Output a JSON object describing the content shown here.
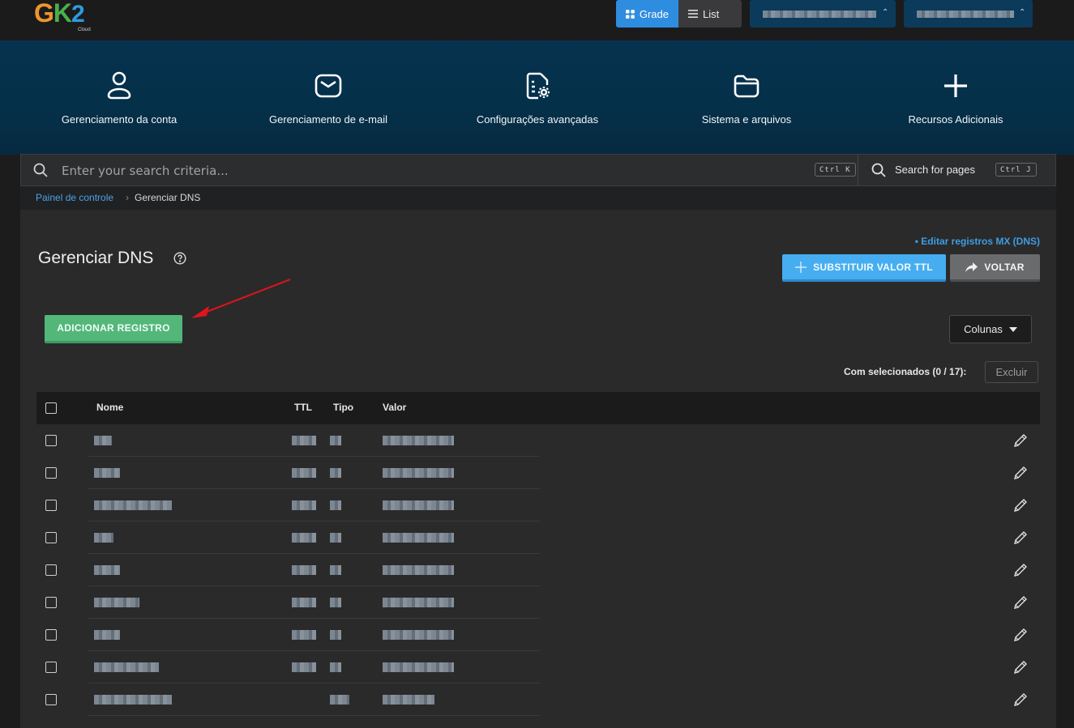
{
  "logo": {
    "g": "G",
    "k": "K",
    "two": "2",
    "sub": "Cloud"
  },
  "view_toggle": {
    "grade": "Grade",
    "list": "List"
  },
  "hero": [
    {
      "label": "Gerenciamento da conta",
      "icon": "user-icon"
    },
    {
      "label": "Gerenciamento de e-mail",
      "icon": "mail-icon"
    },
    {
      "label": "Configurações avançadas",
      "icon": "file-settings-icon"
    },
    {
      "label": "Sistema e arquivos",
      "icon": "folder-icon"
    },
    {
      "label": "Recursos Adicionais",
      "icon": "plus-icon"
    }
  ],
  "search": {
    "placeholder": "Enter your search criteria...",
    "shortcut": "Ctrl K",
    "pages_label": "Search for pages",
    "pages_shortcut": "Ctrl J"
  },
  "breadcrumb": {
    "home": "Painel de controle",
    "separator": "›",
    "current": "Gerenciar DNS"
  },
  "page": {
    "title": "Gerenciar DNS",
    "mx_link": "• Editar registros MX (DNS)",
    "ttl_button": "SUBSTITUIR VALOR TTL",
    "back_button": "VOLTAR",
    "add_button": "ADICIONAR REGISTRO",
    "columns_button": "Colunas",
    "selected_label": "Com selecionados (0 / 17):",
    "delete_button": "Excluir"
  },
  "table": {
    "headers": {
      "name": "Nome",
      "ttl": "TTL",
      "type": "Tipo",
      "value": "Valor"
    },
    "rows": [
      {
        "name_w": 22,
        "ttl_w": 30,
        "type_w": 14,
        "value_w": 88
      },
      {
        "name_w": 32,
        "ttl_w": 30,
        "type_w": 14,
        "value_w": 88
      },
      {
        "name_w": 96,
        "ttl_w": 30,
        "type_w": 14,
        "value_w": 88
      },
      {
        "name_w": 24,
        "ttl_w": 30,
        "type_w": 14,
        "value_w": 88
      },
      {
        "name_w": 32,
        "ttl_w": 30,
        "type_w": 14,
        "value_w": 88
      },
      {
        "name_w": 56,
        "ttl_w": 30,
        "type_w": 14,
        "value_w": 88
      },
      {
        "name_w": 32,
        "ttl_w": 30,
        "type_w": 14,
        "value_w": 88
      },
      {
        "name_w": 80,
        "ttl_w": 30,
        "type_w": 14,
        "value_w": 88
      },
      {
        "name_w": 96,
        "ttl_w": 0,
        "type_w": 24,
        "value_w": 64
      }
    ]
  },
  "colors": {
    "accent": "#2f8de0",
    "success": "#53b77a",
    "link": "#3e9de3",
    "hero_bg": "#06324f"
  }
}
